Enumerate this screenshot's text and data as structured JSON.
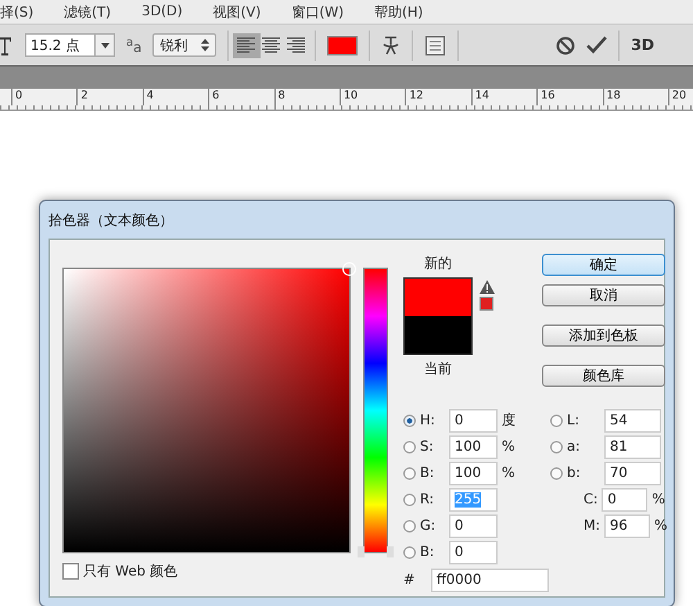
{
  "menu": [
    {
      "label": "择(S)"
    },
    {
      "label": "滤镜(T)"
    },
    {
      "label": "3D(D)"
    },
    {
      "label": "视图(V)"
    },
    {
      "label": "窗口(W)"
    },
    {
      "label": "帮助(H)"
    }
  ],
  "toolbar": {
    "font_size": "15.2 点",
    "aa_label": "$^{a}$a",
    "antialias": "锐利",
    "align": [
      {
        "kind": "left",
        "selected": true
      },
      {
        "kind": "center",
        "selected": false
      },
      {
        "kind": "right",
        "selected": false
      }
    ],
    "three_d": "3D"
  },
  "ruler": [
    "0",
    "2",
    "4",
    "6",
    "8",
    "10",
    "12",
    "14",
    "16",
    "18",
    "20"
  ],
  "dialog": {
    "title": "拾色器（文本颜色）",
    "new_label": "新的",
    "current_label": "当前",
    "hue": {
      "level": 0
    },
    "buttons": [
      {
        "label": "确定",
        "selected": true
      },
      {
        "label": "取消",
        "selected": false
      },
      {
        "label": "添加到色板",
        "selected": false
      },
      {
        "label": "颜色库",
        "selected": false
      }
    ],
    "left_fields": [
      {
        "kind": "radio",
        "label": "H:",
        "value": "0",
        "unit": "度",
        "selected": true,
        "highlighted": false
      },
      {
        "kind": "radio",
        "label": "S:",
        "value": "100",
        "unit": "%",
        "selected": false,
        "highlighted": false
      },
      {
        "kind": "radio",
        "label": "B:",
        "value": "100",
        "unit": "%",
        "selected": false,
        "highlighted": false
      },
      {
        "kind": "radio",
        "label": "R:",
        "value": "255",
        "selected": false,
        "highlighted": true
      },
      {
        "kind": "radio",
        "label": "G:",
        "value": "0",
        "selected": false,
        "highlighted": false
      },
      {
        "kind": "radio",
        "label": "B:",
        "value": "0",
        "selected": false,
        "highlighted": false
      }
    ],
    "right_fields": [
      {
        "kind": "radio",
        "label": "L:",
        "value": "54",
        "selected": false
      },
      {
        "kind": "radio",
        "label": "a:",
        "value": "81",
        "selected": false
      },
      {
        "kind": "radio",
        "label": "b:",
        "value": "70",
        "selected": false
      },
      {
        "kind": "plain",
        "label": "C:",
        "value": "0",
        "unit": "%"
      },
      {
        "kind": "plain",
        "label": "M:",
        "value": "96",
        "unit": "%"
      }
    ],
    "web_only": {
      "label": "只有 Web 颜色",
      "checked": false
    },
    "hex_label": "#",
    "hex": "ff0000"
  }
}
